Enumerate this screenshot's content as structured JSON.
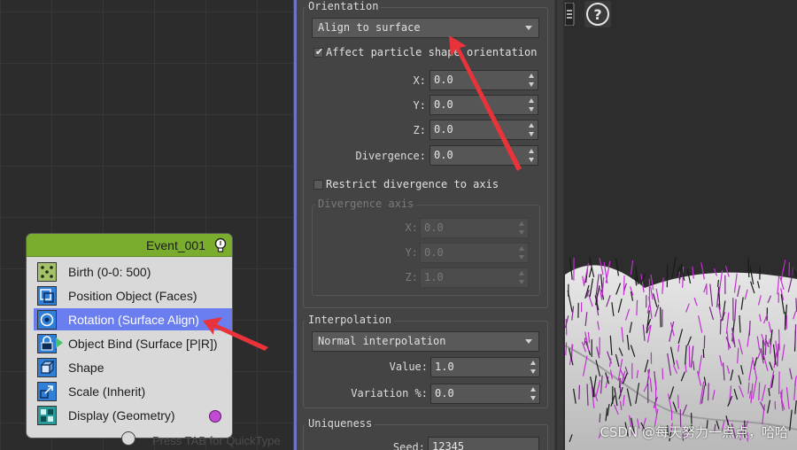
{
  "particle_view": {
    "event": {
      "title": "Event_001",
      "operators": [
        {
          "label": "Birth (0-0: 500)",
          "icon": "birth-icon"
        },
        {
          "label": "Position Object (Faces)",
          "icon": "position-object-icon"
        },
        {
          "label": "Rotation (Surface Align)",
          "icon": "rotation-icon",
          "selected": true
        },
        {
          "label": "Object Bind (Surface [P|R])",
          "icon": "object-bind-icon"
        },
        {
          "label": "Shape",
          "icon": "shape-icon"
        },
        {
          "label": "Scale (Inherit)",
          "icon": "scale-icon"
        },
        {
          "label": "Display (Geometry)",
          "icon": "display-icon",
          "display_color": "#c24bd6"
        }
      ]
    },
    "quicktype_hint": "Press TAB for QuickType"
  },
  "rollout": {
    "orientation": {
      "title": "Orientation",
      "mode": "Align to surface",
      "affect_shape_label": "Affect particle shape orientation",
      "affect_shape_checked": true,
      "x_label": "X:",
      "x_value": "0.0",
      "y_label": "Y:",
      "y_value": "0.0",
      "z_label": "Z:",
      "z_value": "0.0",
      "divergence_label": "Divergence:",
      "divergence_value": "0.0",
      "restrict_label": "Restrict divergence to axis",
      "restrict_checked": false,
      "axis_group": {
        "title": "Divergence axis",
        "x_label": "X:",
        "x_value": "0.0",
        "y_label": "Y:",
        "y_value": "0.0",
        "z_label": "Z:",
        "z_value": "1.0"
      }
    },
    "interpolation": {
      "title": "Interpolation",
      "mode": "Normal interpolation",
      "value_label": "Value:",
      "value": "1.0",
      "variation_label": "Variation %:",
      "variation": "0.0"
    },
    "uniqueness": {
      "title": "Uniqueness",
      "seed_label": "Seed:",
      "seed": "12345"
    }
  },
  "viewport": {
    "help_icon": "help-icon",
    "watermark": "CSDN @每天努力一点点，哈哈"
  },
  "colors": {
    "event_header": "#7aac2e",
    "selection": "#6b7ef0",
    "annotation_arrow": "#e8333a",
    "grass_magenta": "#c030d0"
  }
}
